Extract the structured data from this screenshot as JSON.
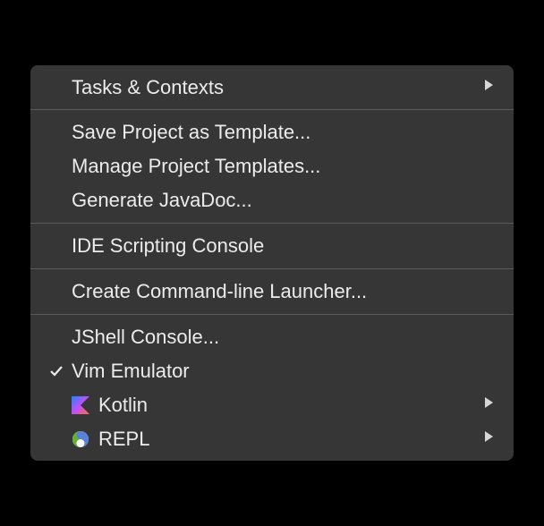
{
  "menu": {
    "groups": [
      [
        {
          "id": "tasks-contexts",
          "label": "Tasks & Contexts",
          "hasSubmenu": true
        }
      ],
      [
        {
          "id": "save-project-template",
          "label": "Save Project as Template..."
        },
        {
          "id": "manage-project-templates",
          "label": "Manage Project Templates..."
        },
        {
          "id": "generate-javadoc",
          "label": "Generate JavaDoc..."
        }
      ],
      [
        {
          "id": "ide-scripting-console",
          "label": "IDE Scripting Console"
        }
      ],
      [
        {
          "id": "create-cli-launcher",
          "label": "Create Command-line Launcher..."
        }
      ],
      [
        {
          "id": "jshell-console",
          "label": "JShell Console..."
        },
        {
          "id": "vim-emulator",
          "label": "Vim Emulator",
          "checked": true
        },
        {
          "id": "kotlin",
          "label": "Kotlin",
          "icon": "kotlin",
          "hasSubmenu": true
        },
        {
          "id": "repl",
          "label": "REPL",
          "icon": "clojure",
          "hasSubmenu": true
        }
      ]
    ]
  }
}
